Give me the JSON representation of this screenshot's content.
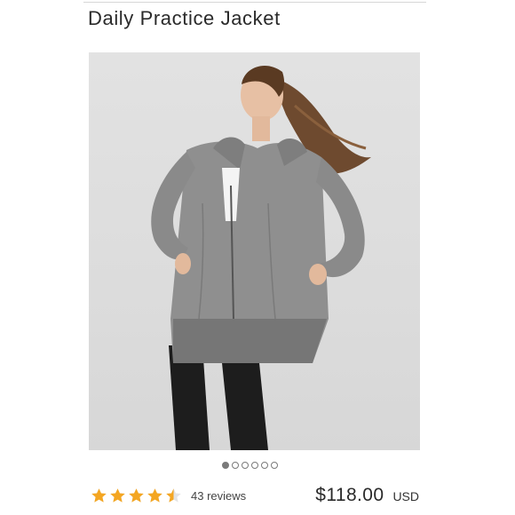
{
  "product": {
    "title": "Daily Practice Jacket",
    "price": "$118.00",
    "currency": "USD"
  },
  "gallery": {
    "image_count": 6,
    "active_index": 0
  },
  "rating": {
    "value": 4.5,
    "max": 5,
    "reviews_label": "43 reviews"
  },
  "colors": {
    "star": "#f4a622",
    "star_empty": "#e3e3e3",
    "dot": "#7a7a7a",
    "background": "#ffffff"
  },
  "icons": {
    "star": "star-icon"
  }
}
